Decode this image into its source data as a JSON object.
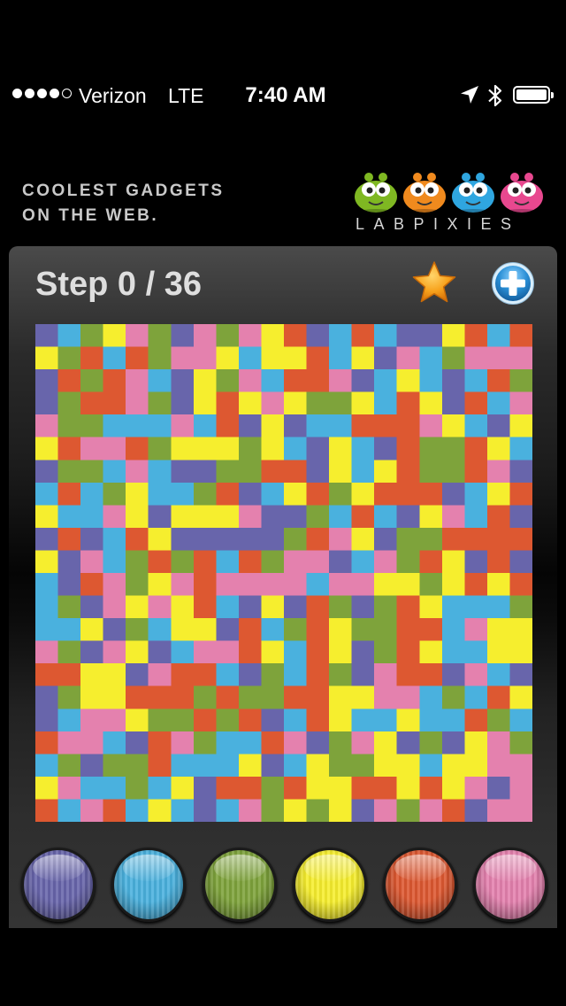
{
  "status_bar": {
    "carrier": "Verizon",
    "network": "LTE",
    "time": "7:40 AM",
    "signal_filled": 4,
    "signal_total": 5,
    "battery_level": 1.0,
    "icons": [
      "location-arrow-icon",
      "bluetooth-icon",
      "battery-icon"
    ]
  },
  "banner": {
    "tagline_line1": "COOLEST GADGETS",
    "tagline_line2": "ON THE WEB.",
    "brand": "LABPIXIES",
    "mascot_colors": [
      "#7fb822",
      "#f08a1e",
      "#2fa6e0",
      "#e8488f"
    ]
  },
  "game": {
    "step_label": "Step 0 / 36",
    "current_step": 0,
    "max_steps": 36,
    "star_icon": "star-icon",
    "plus_icon": "plus-icon"
  },
  "palette": {
    "purple": "#6865ab",
    "blue": "#4ab1de",
    "green": "#7ea33b",
    "yellow": "#f6ee2e",
    "red": "#dd5831",
    "pink": "#e481ae"
  },
  "color_buttons": [
    {
      "name": "purple",
      "color": "#6865ab"
    },
    {
      "name": "blue",
      "color": "#4ab1de"
    },
    {
      "name": "green",
      "color": "#7ea33b"
    },
    {
      "name": "yellow",
      "color": "#f6ee2e"
    },
    {
      "name": "red",
      "color": "#dd5831"
    },
    {
      "name": "pink",
      "color": "#e481ae"
    }
  ],
  "board": {
    "size": 22,
    "rows": [
      "PBGYKGPKGKYRPBRBPPYRBR",
      "YGRBRGKKYBYYRBYPKBGKKK",
      "PRGRKBPYGKBRRKPBYBPBRG",
      "PGRRKGPYRYKYGGYBRYPRBK",
      "KGGBBBKBRPYPBBRRRKYBPY",
      "YRKKRGYYYGYBPYBPRGGRYB",
      "PGGBKBPPGGRRPYBYRGGRKP",
      "BRBGYBBGRPBYRGYRRRPBYR",
      "YBBKYPYYYKPPGBRBPYKBRP",
      "PRPBRYPPPPPGRKYPGGRRRR",
      "YPKBGRGRBRGKKPBKGRYPRP",
      "BPRKGYKRKKKKBKKYYGYRYR",
      "BGPKYKYRBPYPRGPGRYBBBG",
      "BBYPGBYYPRBGRYGGRRBKYY",
      "KGPKYPBKKRYBRYPGRYBBYY",
      "RRYYPKRRBPGBRGPKRRPKBP",
      "PGYYRRRGRGGRRYYKKBGBRY",
      "PBKKYGGRGRPBRYBBYBBRGB",
      "RKKBPRKGBBRKPGKYPGPYKG",
      "BGPGGRBBBYPBYGGYYBYYKK",
      "YKBBGBYPRRGRYYRRYRYKPK",
      "RBKRBYBPBKGYGYPKGKRPKK"
    ]
  }
}
